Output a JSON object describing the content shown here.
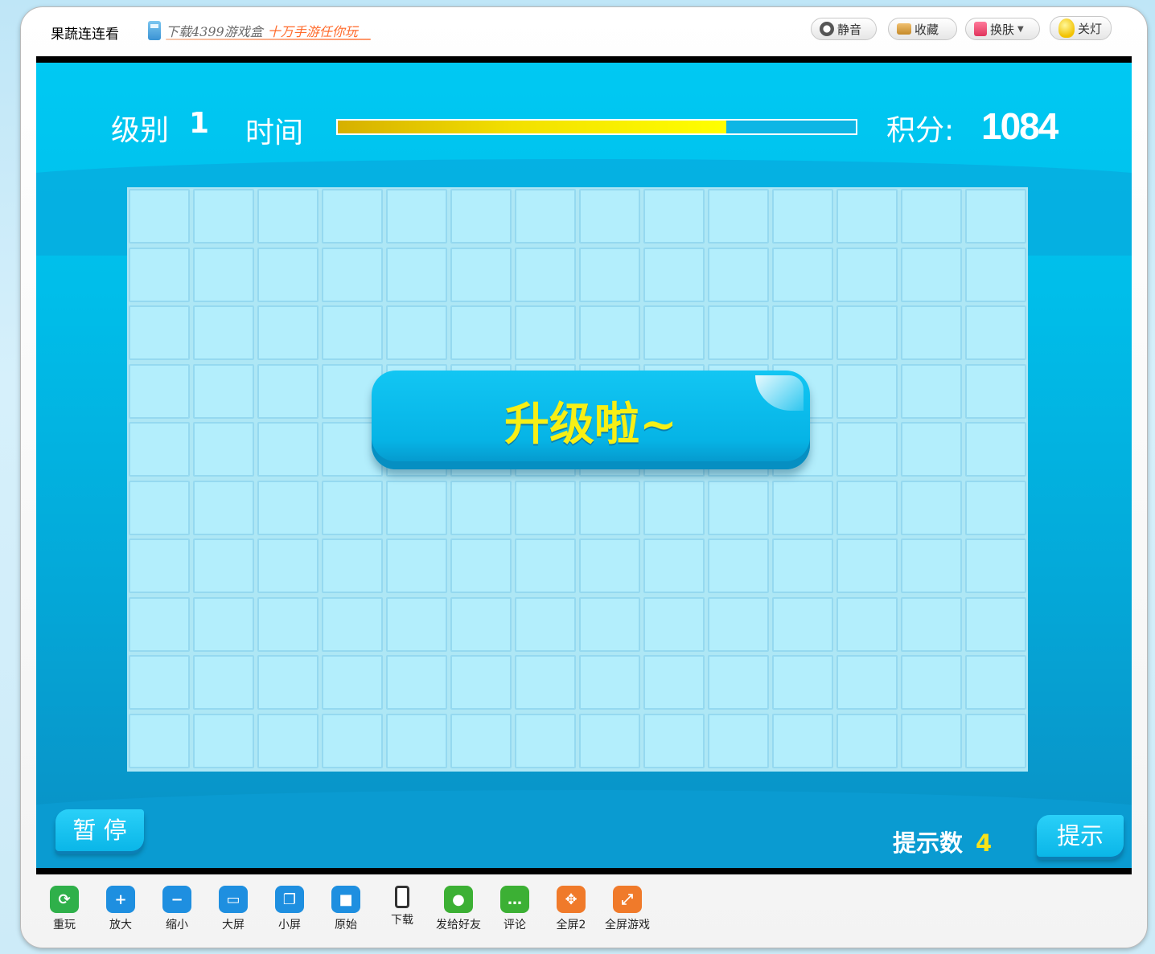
{
  "header": {
    "title": "果蔬连连看",
    "promo_part1": "下载4399游戏盒",
    "promo_part2": "十万手游任你玩",
    "buttons": [
      {
        "label": "静音",
        "icon": "mute-icon"
      },
      {
        "label": "收藏",
        "icon": "favorite-icon"
      },
      {
        "label": "换肤",
        "icon": "skin-icon"
      },
      {
        "label": "关灯",
        "icon": "lightbulb-icon"
      }
    ]
  },
  "game": {
    "level_label": "级别",
    "level_value": "1",
    "time_label": "时间",
    "time_fraction": 0.75,
    "score_label": "积分:",
    "score_value": "1084",
    "grid_rows": 10,
    "grid_cols": 14,
    "banner_text": "升级啦~",
    "pause_label": "暂 停",
    "hint_count_label": "提示数",
    "hint_count_value": "4",
    "hint_label": "提示",
    "colors": {
      "background": "#00c2ef",
      "banner_text": "#f7ef15",
      "timebar_fill": "#ffff00"
    }
  },
  "toolbar": [
    {
      "label": "重玩",
      "icon": "replay-icon",
      "color": "#2fb04a"
    },
    {
      "label": "放大",
      "icon": "zoom-in-icon",
      "color": "#1e8fe0"
    },
    {
      "label": "缩小",
      "icon": "zoom-out-icon",
      "color": "#1e8fe0"
    },
    {
      "label": "大屏",
      "icon": "large-screen-icon",
      "color": "#1e8fe0"
    },
    {
      "label": "小屏",
      "icon": "small-screen-icon",
      "color": "#1e8fe0"
    },
    {
      "label": "原始",
      "icon": "original-size-icon",
      "color": "#1e8fe0"
    },
    {
      "label": "下载",
      "icon": "phone-icon",
      "color": "#333333"
    },
    {
      "label": "发给好友",
      "icon": "qq-icon",
      "color": "#3cb034"
    },
    {
      "label": "评论",
      "icon": "comment-icon",
      "color": "#3cb034"
    },
    {
      "label": "全屏2",
      "icon": "fullscreen2-icon",
      "color": "#f07a2a"
    },
    {
      "label": "全屏游戏",
      "icon": "fullscreen-game-icon",
      "color": "#f07a2a"
    }
  ]
}
